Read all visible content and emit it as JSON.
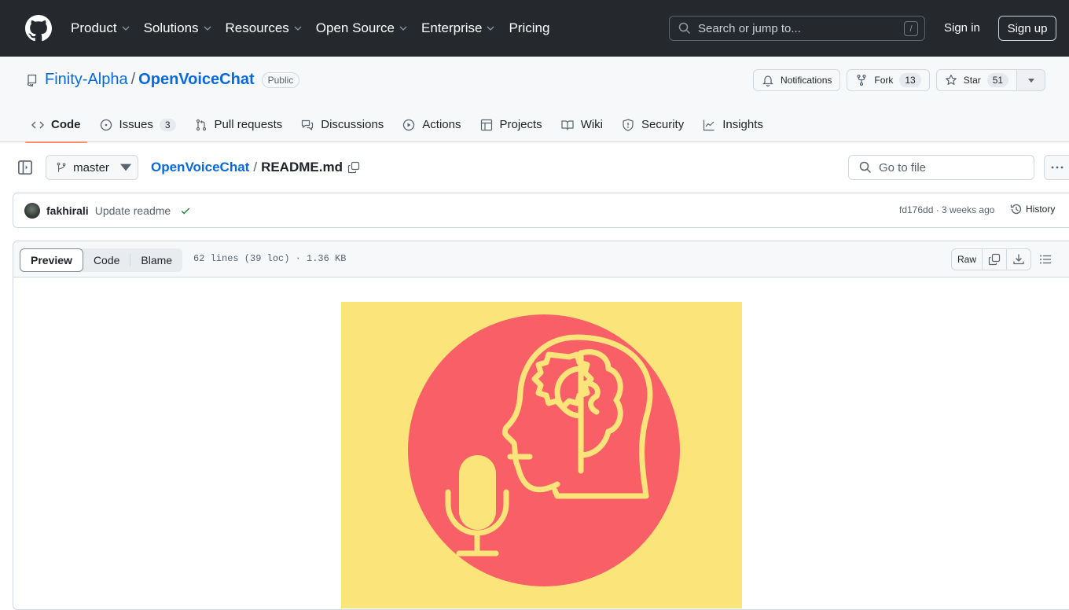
{
  "topbar": {
    "nav": [
      {
        "label": "Product",
        "dropdown": true
      },
      {
        "label": "Solutions",
        "dropdown": true
      },
      {
        "label": "Resources",
        "dropdown": true
      },
      {
        "label": "Open Source",
        "dropdown": true
      },
      {
        "label": "Enterprise",
        "dropdown": true
      },
      {
        "label": "Pricing",
        "dropdown": false
      }
    ],
    "search_placeholder": "Search or jump to...",
    "search_shortcut": "/",
    "sign_in": "Sign in",
    "sign_up": "Sign up"
  },
  "repo": {
    "owner": "Finity-Alpha",
    "separator": "/",
    "name": "OpenVoiceChat",
    "visibility": "Public",
    "notifications_label": "Notifications",
    "fork_label": "Fork",
    "fork_count": "13",
    "star_label": "Star",
    "star_count": "51"
  },
  "tabs": [
    {
      "label": "Code",
      "icon": "code-icon",
      "active": true
    },
    {
      "label": "Issues",
      "icon": "issue-icon",
      "count": "3"
    },
    {
      "label": "Pull requests",
      "icon": "pull-request-icon"
    },
    {
      "label": "Discussions",
      "icon": "discussions-icon"
    },
    {
      "label": "Actions",
      "icon": "play-icon"
    },
    {
      "label": "Projects",
      "icon": "table-icon"
    },
    {
      "label": "Wiki",
      "icon": "book-icon"
    },
    {
      "label": "Security",
      "icon": "shield-icon"
    },
    {
      "label": "Insights",
      "icon": "graph-icon"
    }
  ],
  "file": {
    "branch": "master",
    "path_repo": "OpenVoiceChat",
    "path_sep": "/",
    "path_file": "README.md",
    "goto_placeholder": "Go to file"
  },
  "commit": {
    "author": "fakhirali",
    "message": "Update readme",
    "status": "success",
    "meta": "fd176dd · 3 weeks ago",
    "history_label": "History"
  },
  "viewer": {
    "modes": [
      "Preview",
      "Code",
      "Blame"
    ],
    "active_mode": "Preview",
    "info": "62 lines (39 loc) · 1.36 KB",
    "raw_label": "Raw"
  },
  "readme_image": {
    "description": "Head with brain-gear and microphone logo",
    "background": "#fbe47a",
    "circle": "#f95f66",
    "line": "#fbe47a"
  }
}
